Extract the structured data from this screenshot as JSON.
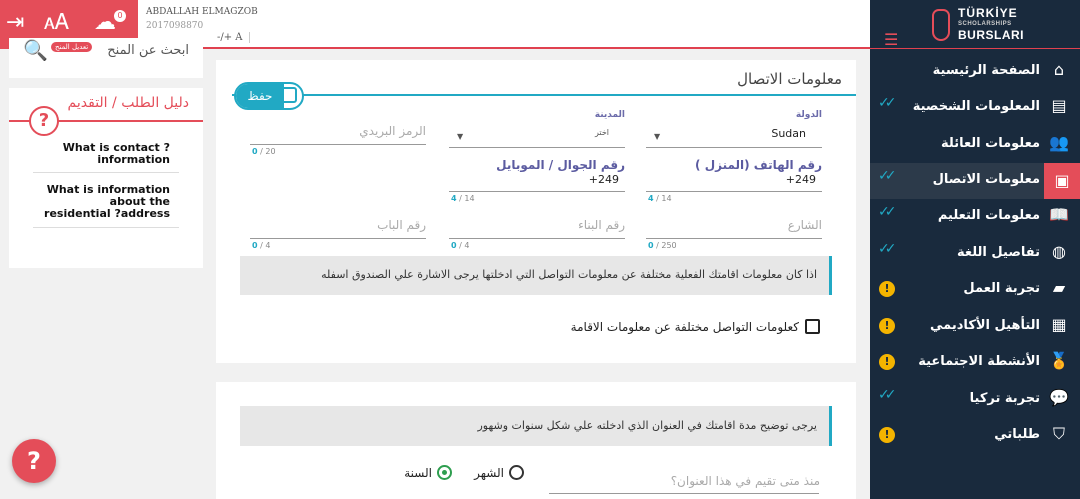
{
  "topbar": {
    "user_name": "ABDALLAH ELMAGZOB",
    "user_id": "2017098870",
    "font_size_label": "-/+ A",
    "upload_badge": "0"
  },
  "sidebar": {
    "brand_line1": "TÜRKİYE",
    "brand_line2": "SCHOLARSHIPS",
    "brand_line3": "BURSLARI",
    "items": [
      {
        "label": "الصفحة الرئيسية",
        "icon": "home-icon",
        "status": "none"
      },
      {
        "label": "المعلومات الشخصية",
        "icon": "id-card-icon",
        "status": "done"
      },
      {
        "label": "معلومات العائلة",
        "icon": "users-icon",
        "status": "done"
      },
      {
        "label": "معلومات الاتصال",
        "icon": "contact-card-icon",
        "status": "done"
      },
      {
        "label": "معلومات التعليم",
        "icon": "book-icon",
        "status": "done"
      },
      {
        "label": "تفاصيل اللغة",
        "icon": "globe-icon",
        "status": "done"
      },
      {
        "label": "تجربة العمل",
        "icon": "briefcase-icon",
        "status": "warn"
      },
      {
        "label": "التأهيل الأكاديمي",
        "icon": "certificate-icon",
        "status": "warn"
      },
      {
        "label": "الأنشطة الاجتماعية",
        "icon": "medal-icon",
        "status": "warn"
      },
      {
        "label": "تجربة تركيا",
        "icon": "chat-icon",
        "status": "done"
      },
      {
        "label": "طلباتي",
        "icon": "shield-check-icon",
        "status": "warn"
      }
    ]
  },
  "left": {
    "search_text": "ابحث عن المنح",
    "search_badge": "تعديل المنح",
    "guide_title": "دليل الطلب / التقديم",
    "faq": [
      "What is contact ?information",
      "What is information about the residential ?address"
    ]
  },
  "contact": {
    "title": "معلومات الاتصال",
    "save_label": "حفظ",
    "country_label": "الدولة",
    "country_value": "Sudan",
    "city_label": "المدينة",
    "city_value": "اختر",
    "postal_placeholder": "الرمز البريدي",
    "postal_count": "0",
    "postal_max": "20",
    "home_phone_label": "رقم الهاتف (المنزل )",
    "home_phone_value": "+249",
    "home_phone_count": "4",
    "home_phone_max": "14",
    "mobile_label": "رقم الجوال / الموبايل",
    "mobile_value": "+249",
    "mobile_count": "4",
    "mobile_max": "14",
    "street_placeholder": "الشارع",
    "street_count": "0",
    "street_max": "250",
    "building_placeholder": "رقم البناء",
    "building_count": "0",
    "building_max": "4",
    "door_placeholder": "رقم الباب",
    "door_count": "0",
    "door_max": "4",
    "info_text": "اذا كان معلومات اقامتك الفعلية مختلفة عن معلومات التواصل التي ادخلتها يرجى الاشارة علي الصندوق اسفله",
    "checkbox_label": "كعلومات التواصل مختلفة عن معلومات الاقامة"
  },
  "residence": {
    "info_text": "يرجى توضيح مدة اقامتك في العنوان الذي ادخلته علي شكل سنوات وشهور",
    "month_label": "الشهر",
    "year_label": "السنة",
    "selected": "year",
    "since_placeholder": "منذ متى تقيم في هذا العنوان؟"
  },
  "help_label": "?",
  "colors": {
    "accent_red": "#e44d59",
    "accent_cyan": "#21a9c4",
    "sidebar_bg": "#192a3d"
  }
}
